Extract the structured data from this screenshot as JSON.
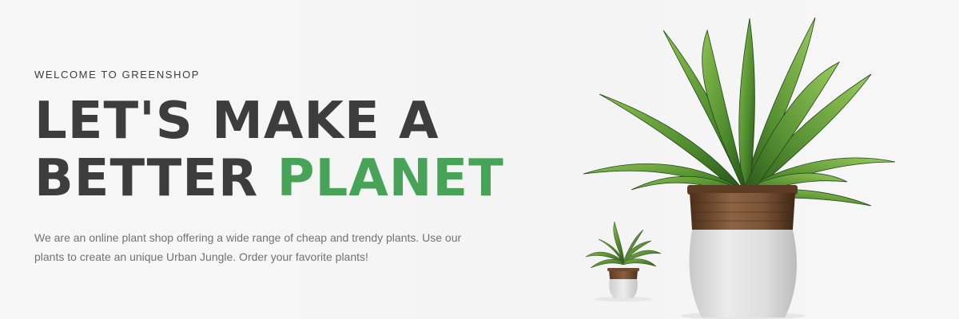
{
  "hero": {
    "eyebrow": "WELCOME TO GREENSHOP",
    "headline_line1": "LET'S MAKE A",
    "headline_line2_prefix": "BETTER ",
    "headline_line2_accent": "PLANET",
    "description": "We are an online plant shop offering a wide range of cheap and trendy plants. Use our plants to create an unique Urban Jungle. Order your favorite plants!"
  },
  "colors": {
    "accent": "#46a358",
    "heading": "#3d3d3d",
    "body_text": "#727272",
    "background": "#f6f6f6"
  },
  "images": {
    "small_plant": "potted-plant-small",
    "large_plant": "potted-plant-large"
  }
}
